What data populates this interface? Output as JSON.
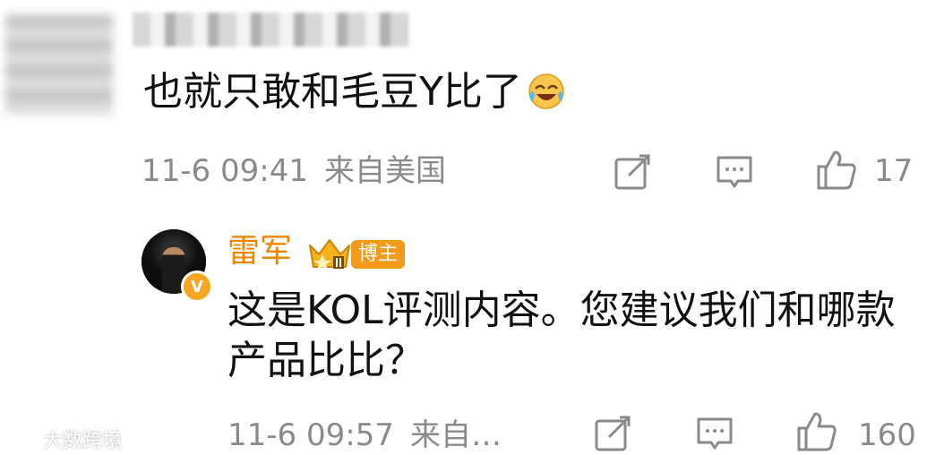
{
  "comment": {
    "text": "也就只敢和毛豆Y比了",
    "emoji": "laughing-crying-emoji",
    "date": "11-6 09:41",
    "location": "来自美国",
    "likes": "17"
  },
  "reply": {
    "author": "雷军",
    "role_badge": "博主",
    "text": "这是KOL评测内容。您建议我们和哪款产品比比？",
    "date": "11-6 09:57",
    "location": "来自…",
    "likes": "160"
  },
  "watermark": {
    "text": "大数跨境"
  },
  "colors": {
    "author_name": "#f08300",
    "badge": "#f39a18",
    "meta_text": "#8a8a8a"
  }
}
